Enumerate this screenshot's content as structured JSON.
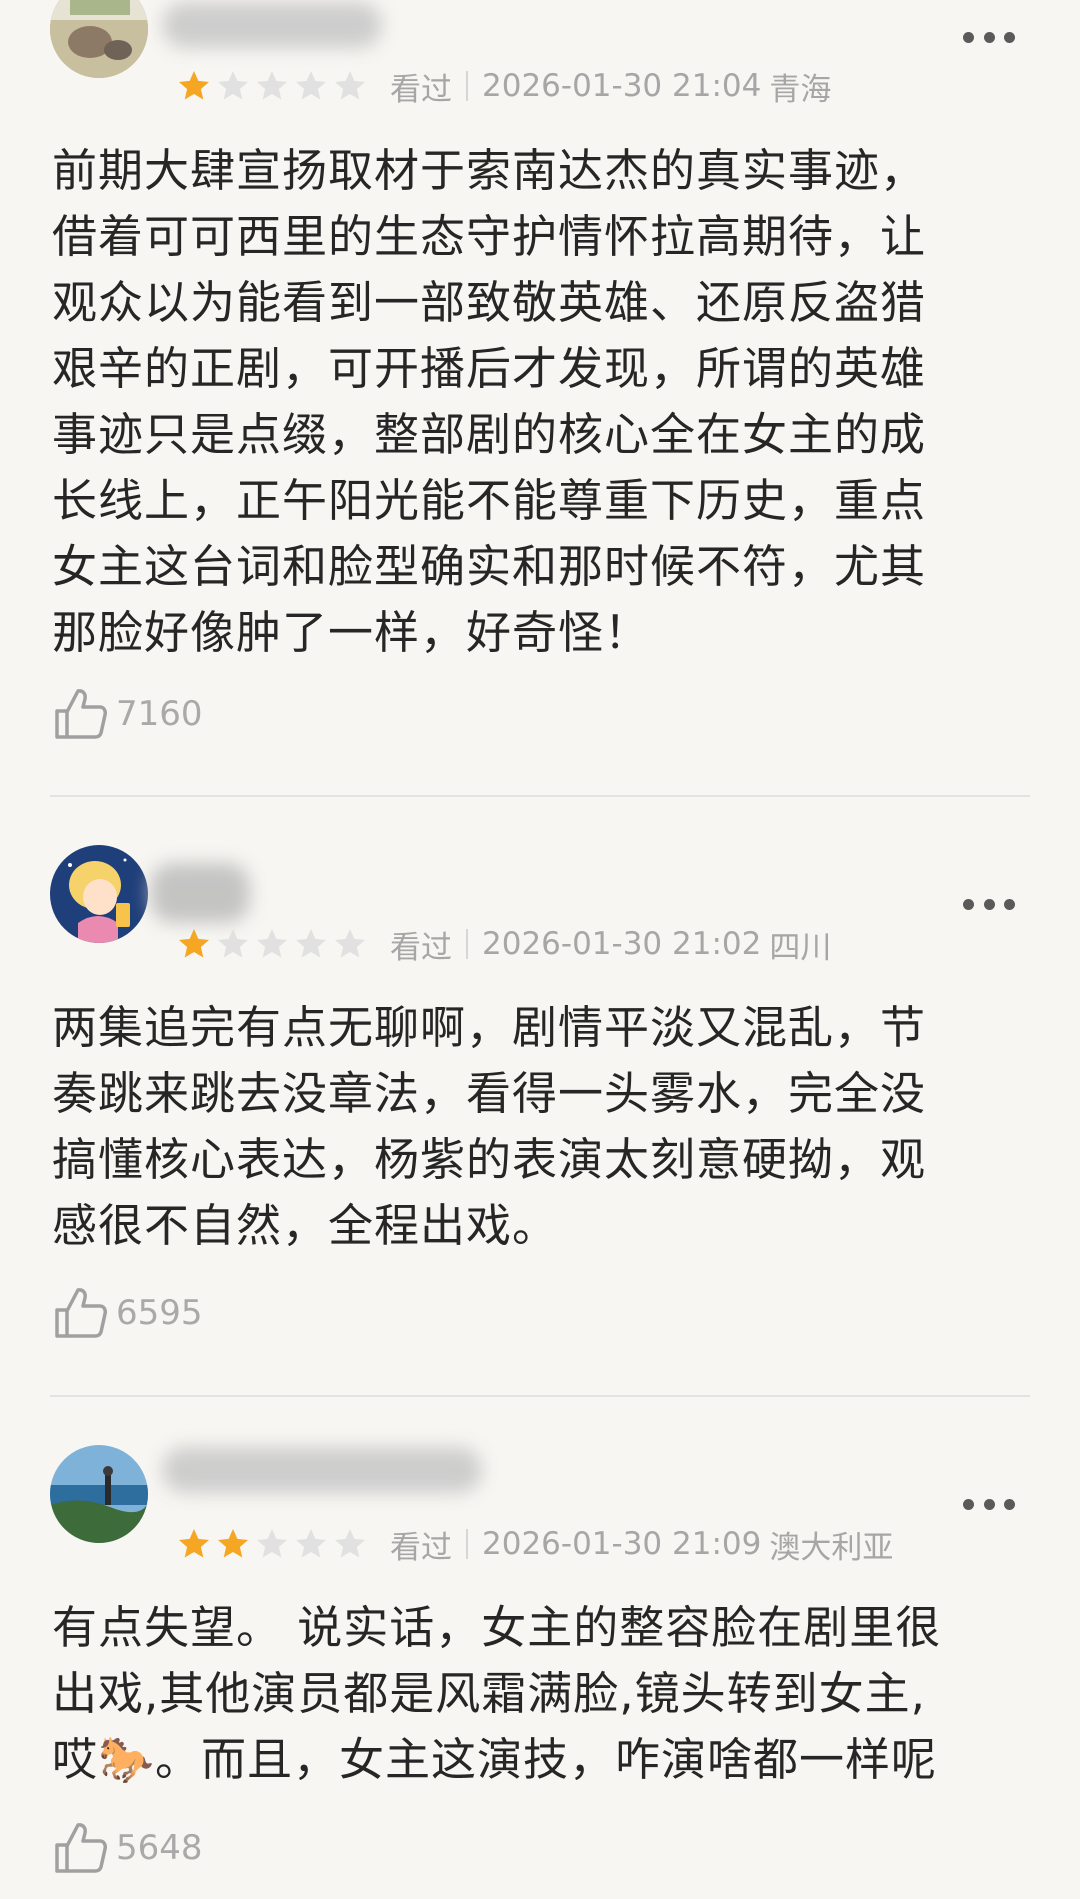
{
  "reviews": [
    {
      "rating": 1,
      "status": "看过",
      "datetime": "2026-01-30 21:04",
      "location": "青海",
      "text": "前期大肆宣扬取材于索南达杰的真实事迹，\n借着可可西里的生态守护情怀拉高期待，让\n观众以为能看到一部致敬英雄、还原反盗猎\n艰辛的正剧，可开播后才发现，所谓的英雄\n事迹只是点缀，整部剧的核心全在女主的成\n长线上，正午阳光能不能尊重下历史，重点\n女主这台词和脸型确实和那时候不符，尤其\n那脸好像肿了一样，好奇怪！",
      "likes": "7160"
    },
    {
      "rating": 1,
      "status": "看过",
      "datetime": "2026-01-30 21:02",
      "location": "四川",
      "text": "两集追完有点无聊啊，剧情平淡又混乱，节\n奏跳来跳去没章法，看得一头雾水，完全没\n搞懂核心表达，杨紫的表演太刻意硬拗，观\n感很不自然，全程出戏。",
      "likes": "6595"
    },
    {
      "rating": 2,
      "status": "看过",
      "datetime": "2026-01-30 21:09",
      "location": "澳大利亚",
      "text": "有点失望。 说实话，女主的整容脸在剧里很\n出戏,其他演员都是风霜满脸,镜头转到女主,\n哎🐎。而且，女主这演技，咋演啥都一样呢",
      "likes": "5648"
    }
  ],
  "colors": {
    "star_on": "#f5a623",
    "star_off": "#e1e1e1",
    "background": "#f7f6f2"
  }
}
